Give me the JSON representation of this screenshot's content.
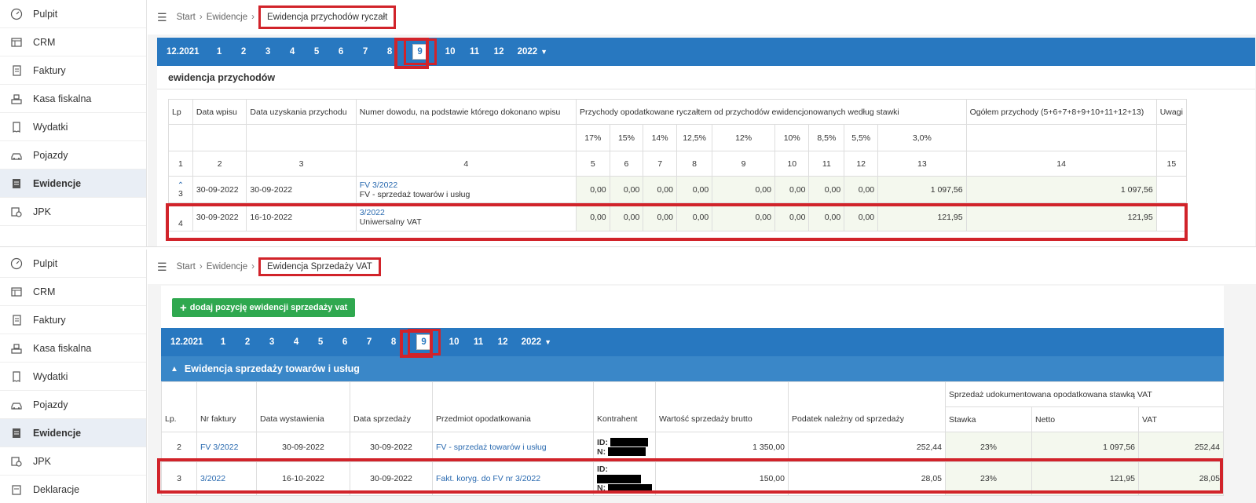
{
  "sidebar": {
    "items": [
      {
        "label": "Pulpit",
        "icon": "dashboard-icon"
      },
      {
        "label": "CRM",
        "icon": "crm-icon"
      },
      {
        "label": "Faktury",
        "icon": "invoice-icon"
      },
      {
        "label": "Kasa fiskalna",
        "icon": "cash-register-icon"
      },
      {
        "label": "Wydatki",
        "icon": "receipt-icon"
      },
      {
        "label": "Pojazdy",
        "icon": "car-icon"
      },
      {
        "label": "Ewidencje",
        "icon": "records-icon"
      },
      {
        "label": "JPK",
        "icon": "jpk-icon"
      },
      {
        "label": "Deklaracje",
        "icon": "declarations-icon"
      }
    ],
    "active": "Ewidencje"
  },
  "top": {
    "breadcrumb": {
      "start": "Start",
      "mid": "Ewidencje",
      "current": "Ewidencja przychodów ryczałt"
    },
    "months": {
      "prev_year": "12.2021",
      "list": [
        "1",
        "2",
        "3",
        "4",
        "5",
        "6",
        "7",
        "8",
        "9",
        "10",
        "11",
        "12"
      ],
      "selected": "9",
      "year": "2022"
    },
    "section_title": "ewidencja przychodów",
    "table": {
      "headers": {
        "lp": "Lp",
        "data_wpisu": "Data wpisu",
        "data_uzyskania": "Data uzyskania przychodu",
        "numer_dowodu": "Numer dowodu, na podstawie którego dokonano wpisu",
        "przychody": "Przychody opodatkowane ryczałtem od przychodów ewidencjonowanych według stawki",
        "ogolem": "Ogółem przychody (5+6+7+8+9+10+11+12+13)",
        "uwagi": "Uwagi"
      },
      "rates": [
        "17%",
        "15%",
        "14%",
        "12,5%",
        "12%",
        "10%",
        "8,5%",
        "5,5%",
        "3,0%"
      ],
      "col_numbers": [
        "1",
        "2",
        "3",
        "4",
        "5",
        "6",
        "7",
        "8",
        "9",
        "10",
        "11",
        "12",
        "13",
        "14",
        "15"
      ],
      "rows": [
        {
          "lp": "3",
          "data_wpisu": "30-09-2022",
          "data_uzyskania": "30-09-2022",
          "doc_no": "FV 3/2022",
          "doc_desc": "FV - sprzedaż towarów i usług",
          "vals": [
            "0,00",
            "0,00",
            "0,00",
            "0,00",
            "0,00",
            "0,00",
            "0,00",
            "0,00",
            "1 097,56"
          ],
          "total": "1 097,56"
        },
        {
          "lp": "4",
          "data_wpisu": "30-09-2022",
          "data_uzyskania": "16-10-2022",
          "doc_no": "3/2022",
          "doc_desc": "Uniwersalny VAT",
          "vals": [
            "0,00",
            "0,00",
            "0,00",
            "0,00",
            "0,00",
            "0,00",
            "0,00",
            "0,00",
            "121,95"
          ],
          "total": "121,95"
        }
      ]
    }
  },
  "bottom": {
    "breadcrumb": {
      "start": "Start",
      "mid": "Ewidencje",
      "current": "Ewidencja Sprzedaży VAT"
    },
    "add_button": "dodaj pozycję ewidencji sprzedaży vat",
    "months": {
      "prev_year": "12.2021",
      "list": [
        "1",
        "2",
        "3",
        "4",
        "5",
        "6",
        "7",
        "8",
        "9",
        "10",
        "11",
        "12"
      ],
      "selected": "9",
      "year": "2022"
    },
    "section_header": "Ewidencja sprzedaży towarów i usług",
    "table": {
      "group_header": "Sprzedaż udokumentowana opodatkowana stawką VAT",
      "headers": [
        "Lp.",
        "Nr faktury",
        "Data wystawienia",
        "Data sprzedaży",
        "Przedmiot opodatkowania",
        "Kontrahent",
        "Wartość sprzedaży brutto",
        "Podatek należny od sprzedaży",
        "Stawka",
        "Netto",
        "VAT"
      ],
      "rows": [
        {
          "lp": "2",
          "nr": "FV 3/2022",
          "data_wyst": "30-09-2022",
          "data_sprz": "30-09-2022",
          "przedmiot": "FV - sprzedaż towarów i usług",
          "id_label": "ID:",
          "n_label": "N:",
          "brutto": "1 350,00",
          "podatek": "252,44",
          "stawka": "23%",
          "netto": "1 097,56",
          "vat": "252,44"
        },
        {
          "lp": "3",
          "nr": "3/2022",
          "data_wyst": "16-10-2022",
          "data_sprz": "30-09-2022",
          "przedmiot": "Fakt. koryg. do FV nr 3/2022",
          "id_label": "ID:",
          "n_label": "N:",
          "brutto": "150,00",
          "podatek": "28,05",
          "stawka": "23%",
          "netto": "121,95",
          "vat": "28,05"
        }
      ]
    }
  },
  "colors": {
    "accent": "#2878c0",
    "highlight": "#d1232a",
    "add_button": "#2fa84f"
  }
}
